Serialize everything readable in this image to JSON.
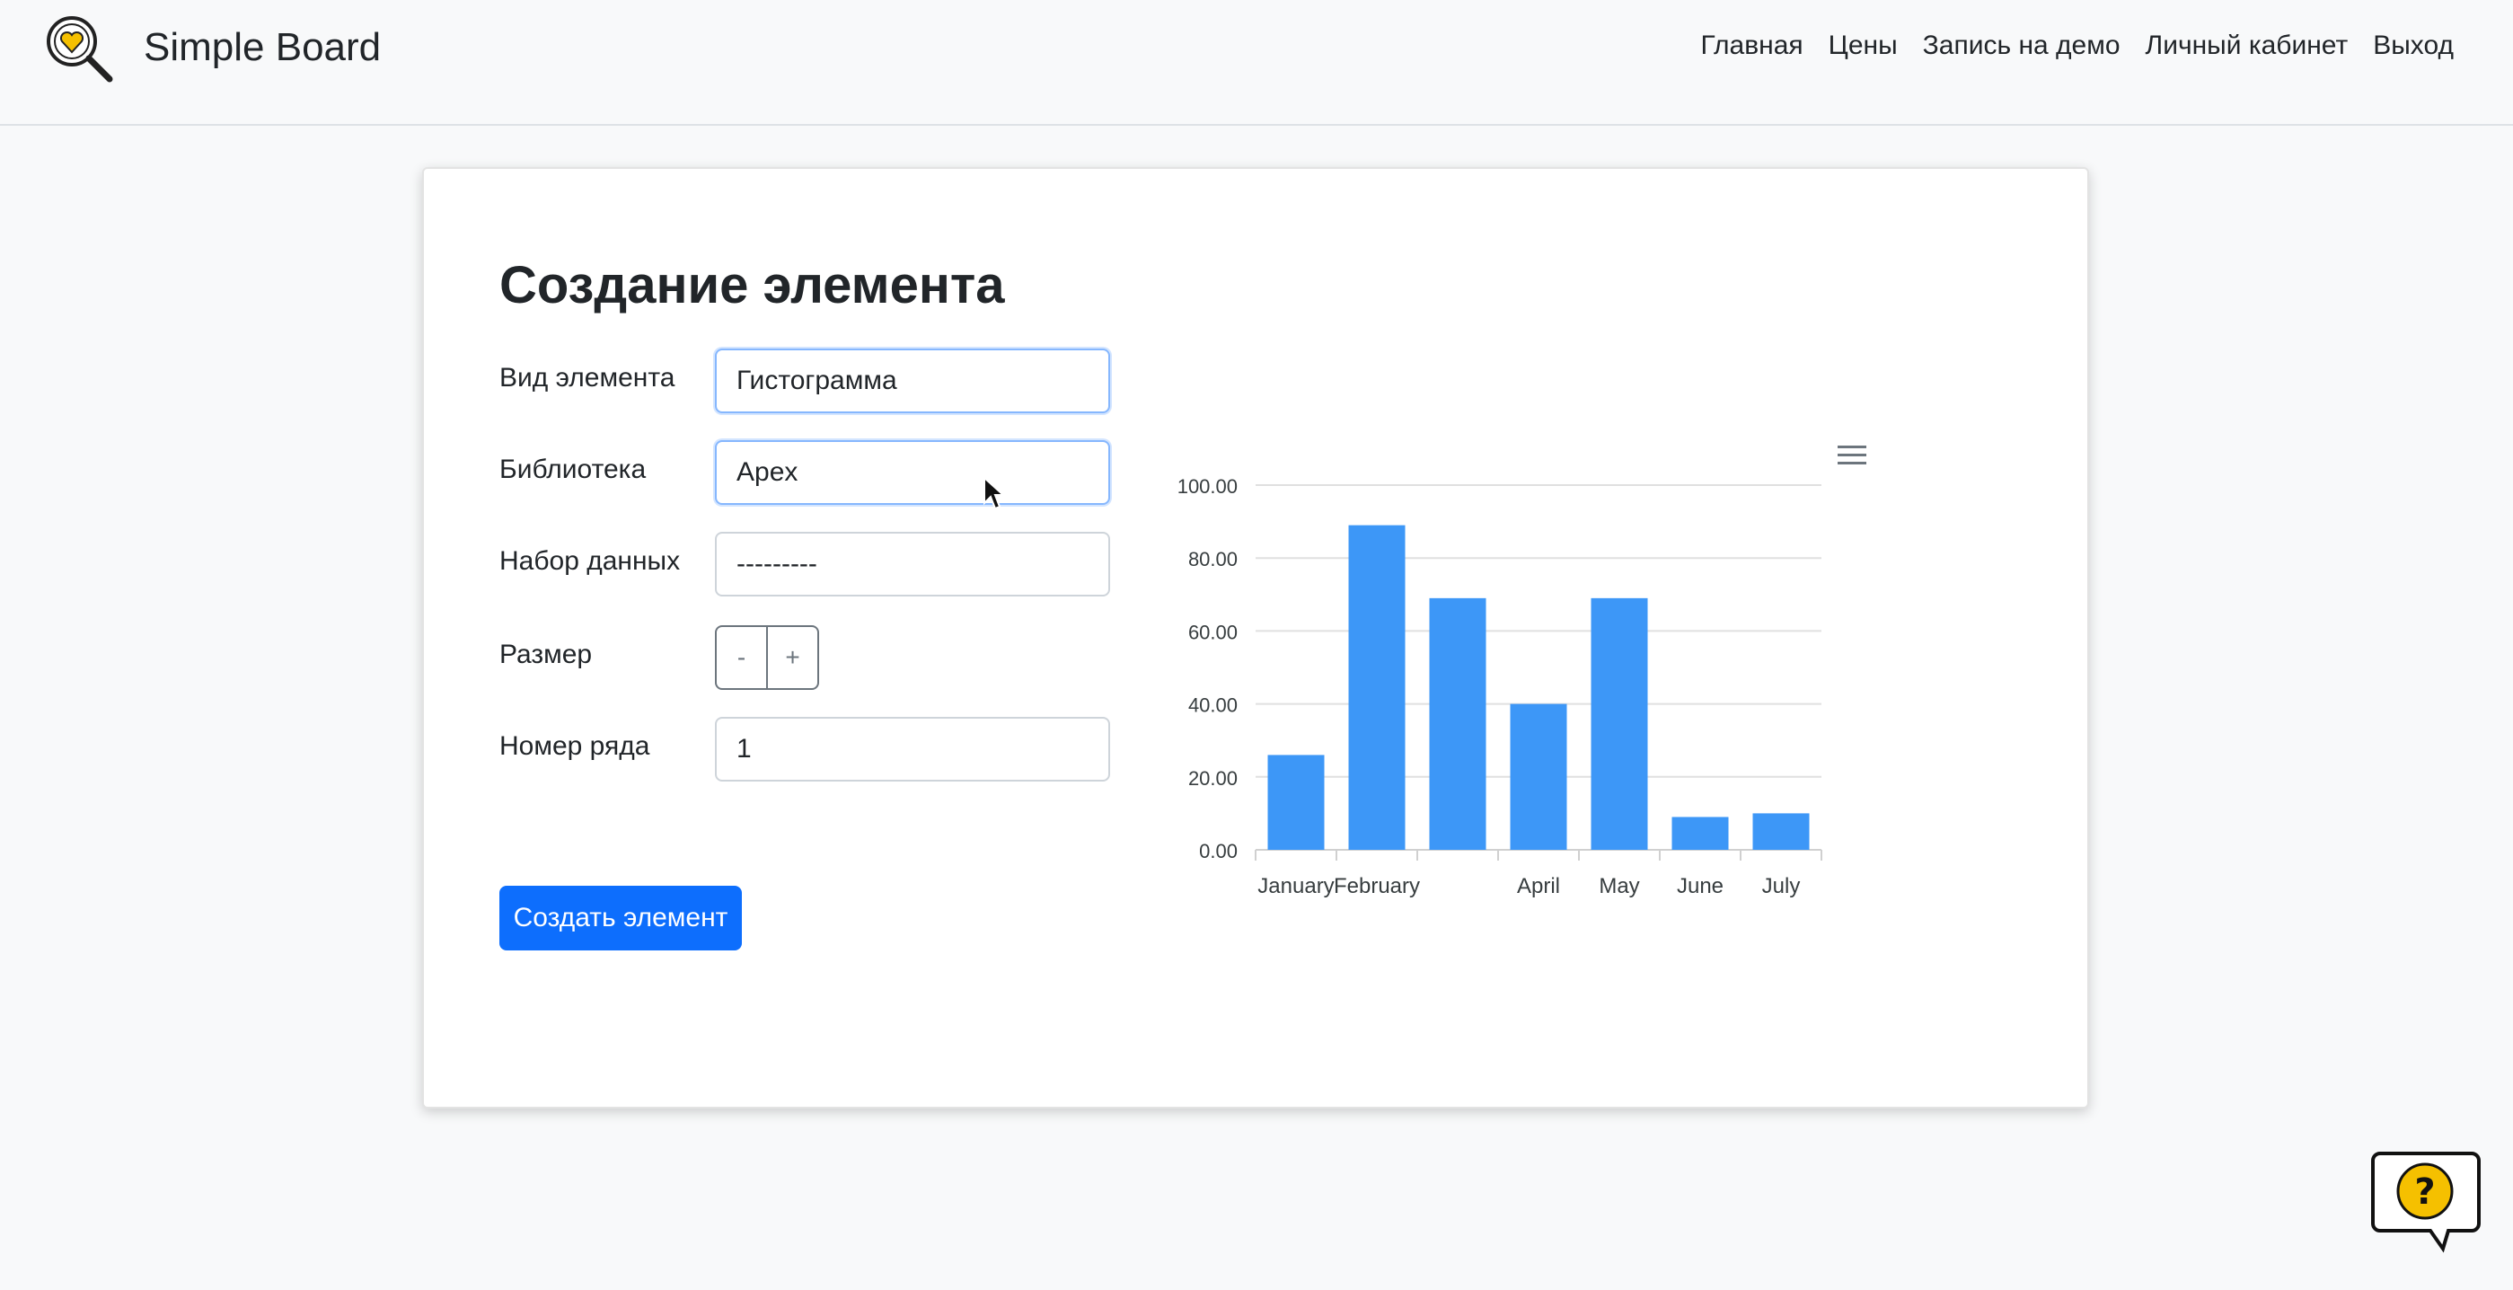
{
  "header": {
    "brand": "Simple Board",
    "nav": [
      "Главная",
      "Цены",
      "Запись на демо",
      "Личный кабинет",
      "Выход"
    ]
  },
  "form": {
    "title": "Создание элемента",
    "fields": [
      {
        "label": "Вид элемента",
        "value": "Гистограмма"
      },
      {
        "label": "Библиотека",
        "value": "Apex"
      },
      {
        "label": "Набор данных",
        "value": "---------"
      },
      {
        "label": "Размер",
        "stepper_minus": "-",
        "stepper_plus": "+"
      },
      {
        "label": "Номер ряда",
        "value": "1"
      }
    ],
    "submit_label": "Создать элемент"
  },
  "colors": {
    "accent": "#0d6efd",
    "bar": "#3d97f7",
    "logo_yellow": "#f5c000"
  },
  "icons": [
    "logo-magnifier-heart-icon",
    "hamburger-menu-icon",
    "help-question-bubble-icon",
    "mouse-cursor-icon"
  ],
  "chart_data": {
    "type": "bar",
    "categories": [
      "January",
      "February",
      "",
      "April",
      "May",
      "June",
      "July"
    ],
    "values": [
      26,
      89,
      69,
      40,
      69,
      9,
      10
    ],
    "ylim": [
      0,
      100
    ],
    "yticks": [
      "0.00",
      "20.00",
      "40.00",
      "60.00",
      "80.00",
      "100.00"
    ],
    "grid": true,
    "title": "",
    "xlabel": "",
    "ylabel": ""
  }
}
